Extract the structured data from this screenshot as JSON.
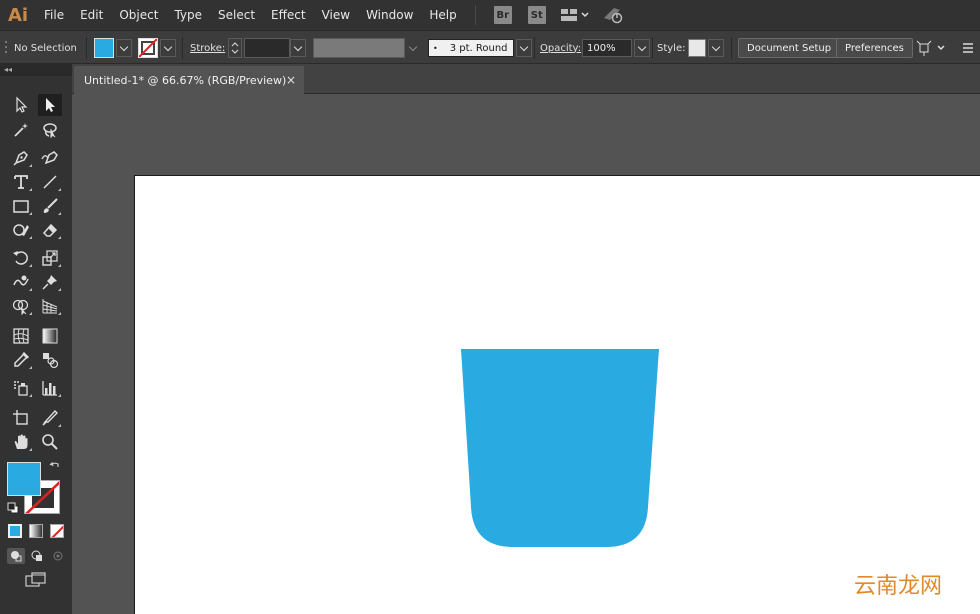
{
  "app": {
    "logo": "Ai",
    "accent": "#c88a4a"
  },
  "menu": {
    "items": [
      "File",
      "Edit",
      "Object",
      "Type",
      "Select",
      "Effect",
      "View",
      "Window",
      "Help"
    ],
    "bridge": "Br",
    "stock": "St"
  },
  "control": {
    "selection": "No Selection",
    "fill_color": "#29abe2",
    "stroke_label": "Stroke:",
    "brush": "3 pt. Round",
    "opacity_label": "Opacity:",
    "opacity_value": "100%",
    "style_label": "Style:",
    "document_setup": "Document Setup",
    "preferences": "Preferences"
  },
  "document": {
    "tab_title": "Untitled-1* @ 66.67% (RGB/Preview)",
    "close": "×"
  },
  "tools": {
    "collapse": "◂◂",
    "fill_color": "#29abe2",
    "stroke_color": "none"
  },
  "artwork": {
    "cup_color": "#29abe2"
  },
  "watermark": "云南龙网"
}
